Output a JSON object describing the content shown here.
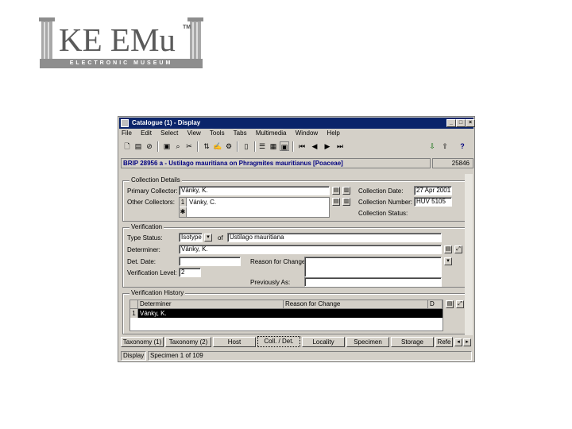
{
  "logo": {
    "name": "KE EMu",
    "tm": "TM",
    "tagline": "ELECTRONIC MUSEUM"
  },
  "window": {
    "title": "Catalogue (1) - Display",
    "controls": {
      "minimize": "_",
      "maximize": "□",
      "close": "×"
    },
    "menu": [
      "File",
      "Edit",
      "Select",
      "View",
      "Tools",
      "Tabs",
      "Multimedia",
      "Window",
      "Help"
    ],
    "record_title": "BRIP 28956 a - Ustilago mauritiana on Phragmites mauritianus [Poaceae]",
    "irn": "25846"
  },
  "collection": {
    "group_label": "Collection Details",
    "primary_collector_label": "Primary Collector:",
    "primary_collector": "Vánky, K.",
    "other_collectors_label": "Other Collectors:",
    "other_collectors": [
      {
        "row": "1",
        "value": "Vánky, C."
      },
      {
        "row": "✱",
        "value": ""
      }
    ],
    "collection_date_label": "Collection Date:",
    "collection_date": "27 Apr 2001",
    "collection_number_label": "Collection Number:",
    "collection_number": "HUV 5105",
    "collection_status_label": "Collection Status:",
    "collection_status": ""
  },
  "verification": {
    "group_label": "Verification",
    "type_status_label": "Type Status:",
    "type_status": "Isotype",
    "of_label": "of",
    "type_of": "Ustilago mauritiana",
    "determiner_label": "Determiner:",
    "determiner": "Vánky, K.",
    "det_date_label": "Det. Date:",
    "det_date": "",
    "reason_label": "Reason for Change:",
    "reason": "",
    "level_label": "Verification Level:",
    "level": "2",
    "previously_label": "Previously As:",
    "previously": ""
  },
  "history": {
    "group_label": "Verification History",
    "columns": [
      "Determiner",
      "Reason for Change",
      "D"
    ],
    "rows": [
      {
        "row": "1",
        "determiner": "Vánky, K.",
        "reason": ""
      }
    ]
  },
  "tabs": [
    "Taxonomy (1)",
    "Taxonomy (2)",
    "Host",
    "Coll. / Det.",
    "Locality",
    "Specimen",
    "Storage",
    "Refe"
  ],
  "status": {
    "mode": "Display",
    "record": "Specimen 1 of 109"
  }
}
